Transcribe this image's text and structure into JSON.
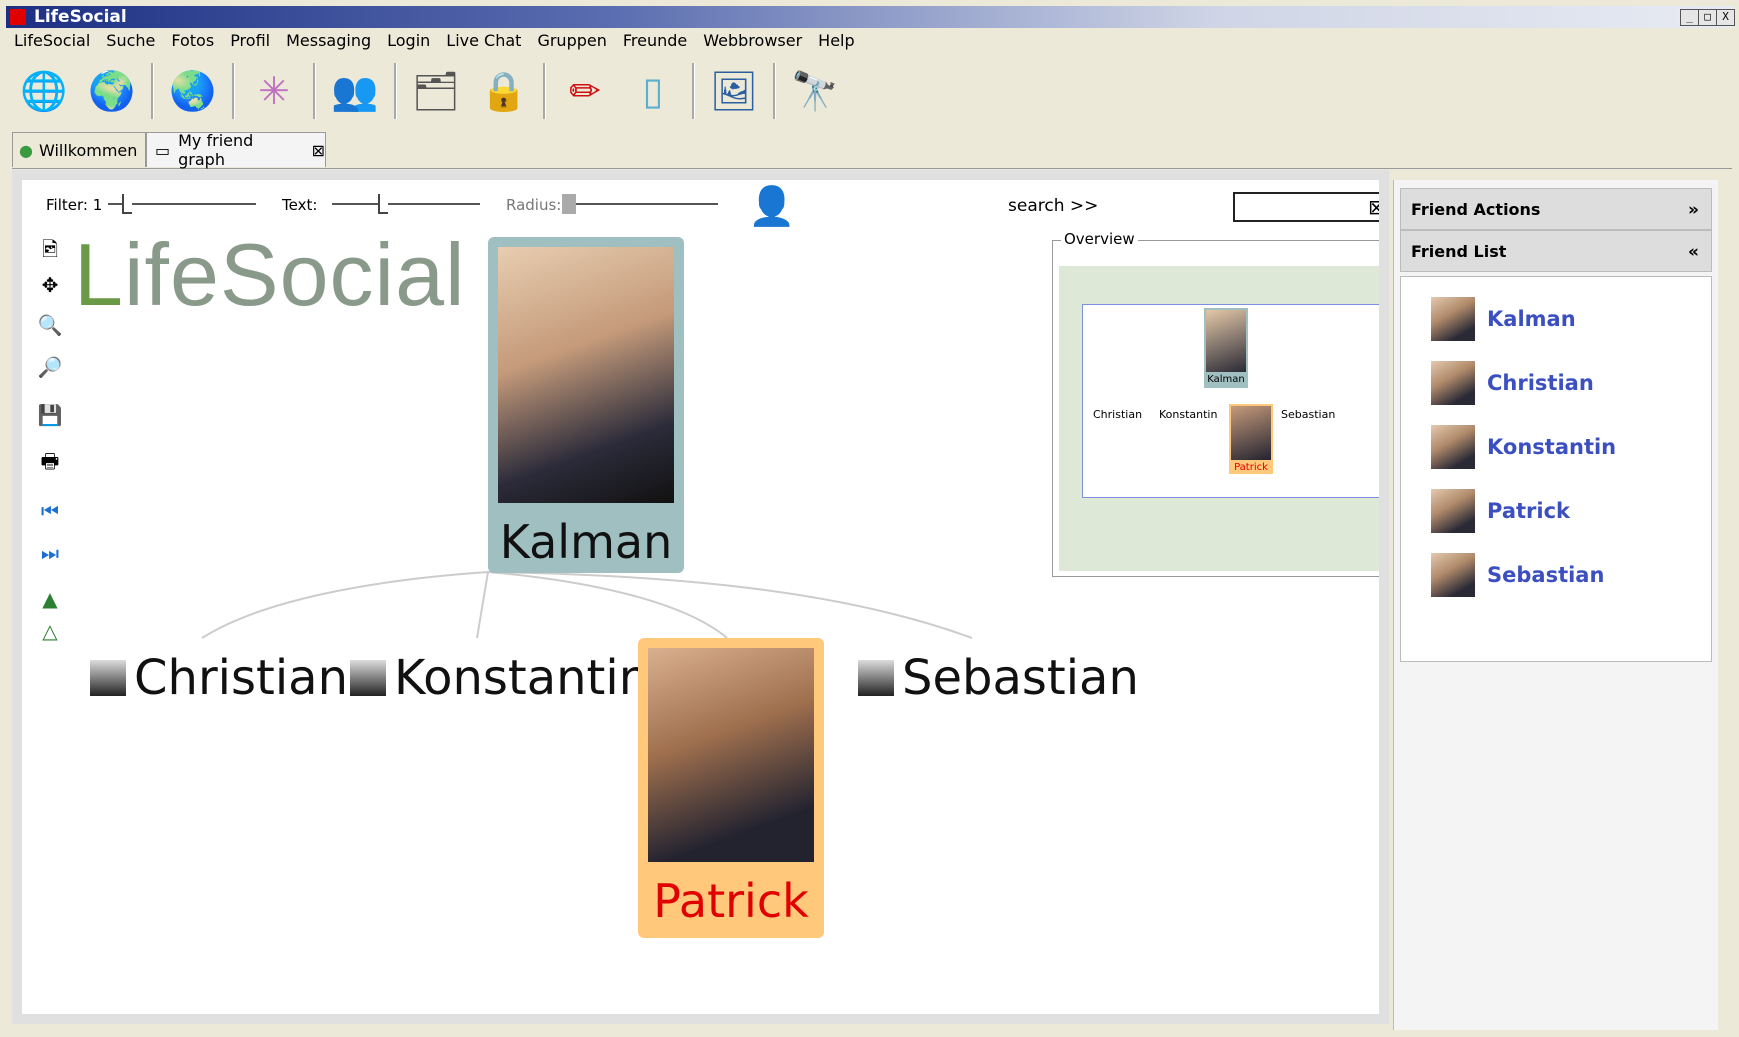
{
  "window": {
    "title": "LifeSocial",
    "controls": [
      "_",
      "□",
      "X"
    ]
  },
  "menu": [
    "LifeSocial",
    "Suche",
    "Fotos",
    "Profil",
    "Messaging",
    "Login",
    "Live Chat",
    "Gruppen",
    "Freunde",
    "Webbrowser",
    "Help"
  ],
  "toolbar": {
    "buttons": [
      "network-globe-icon",
      "globe-icon",
      "web-browser-icon",
      "friend-network-icon",
      "add-friend-icon",
      "edit-icon",
      "lock-icon",
      "pen-icon",
      "document-icon",
      "photo-icon",
      "binoculars-icon"
    ]
  },
  "tabs": [
    {
      "label": "Willkommen",
      "active": false
    },
    {
      "label": "My friend graph",
      "active": true
    }
  ],
  "controls": {
    "filter_label": "Filter: 1",
    "text_label": "Text:",
    "radius_label": "Radius:",
    "search_label": "search >>",
    "search_value": ""
  },
  "brand": {
    "first": "L",
    "rest": "ifeSocial"
  },
  "graph": {
    "center": {
      "name": "Kalman"
    },
    "selected": {
      "name": "Patrick"
    },
    "leaves": [
      "Christian",
      "Konstantin",
      "Sebastian"
    ]
  },
  "overview": {
    "label": "Overview",
    "mini_center": "Kalman",
    "mini_selected": "Patrick",
    "mini_leaves": [
      "Christian",
      "Konstantin",
      "Sebastian"
    ]
  },
  "right_panel": {
    "actions_header": "Friend Actions",
    "list_header": "Friend List",
    "friends": [
      "Kalman",
      "Christian",
      "Konstantin",
      "Patrick",
      "Sebastian"
    ]
  },
  "colors": {
    "accent_link": "#3b4fc0",
    "selected_card": "#ffc87a",
    "center_card": "#9fbfc0",
    "selected_name": "#e00000"
  }
}
